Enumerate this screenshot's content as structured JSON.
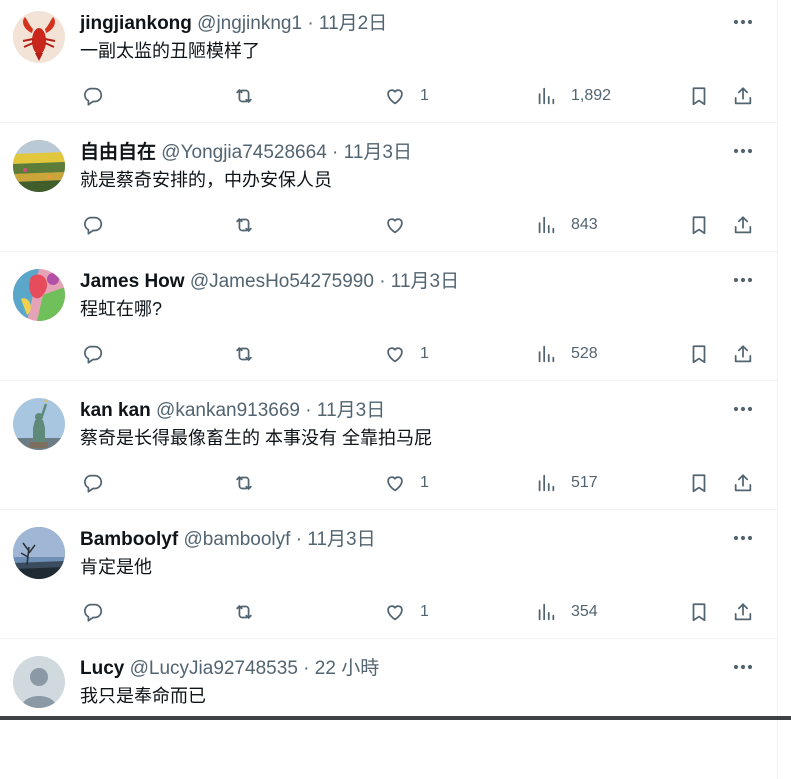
{
  "tweets": [
    {
      "name": "jingjiankong",
      "handle": "@jngjinkng1",
      "dot": "·",
      "time": "11月2日",
      "text": "一副太监的丑陋模样了",
      "replies": "",
      "retweets": "",
      "likes": "1",
      "views": "1,892",
      "avatar_icon": "lobster-avatar"
    },
    {
      "name": "自由自在",
      "handle": "@Yongjia74528664",
      "dot": "·",
      "time": "11月3日",
      "text": "就是蔡奇安排的，中办安保人员",
      "replies": "",
      "retweets": "",
      "likes": "",
      "views": "843",
      "avatar_icon": "flower-field-avatar"
    },
    {
      "name": "James How",
      "handle": "@JamesHo54275990",
      "dot": "·",
      "time": "11月3日",
      "text": "程虹在哪?",
      "replies": "",
      "retweets": "",
      "likes": "1",
      "views": "528",
      "avatar_icon": "painting-avatar"
    },
    {
      "name": "kan kan",
      "handle": "@kankan913669",
      "dot": "·",
      "time": "11月3日",
      "text": "蔡奇是长得最像畜生的 本事没有 全靠拍马屁",
      "replies": "",
      "retweets": "",
      "likes": "1",
      "views": "517",
      "avatar_icon": "statue-of-liberty-avatar"
    },
    {
      "name": "Bamboolyf",
      "handle": "@bamboolyf",
      "dot": "·",
      "time": "11月3日",
      "text": "肯定是他",
      "replies": "",
      "retweets": "",
      "likes": "1",
      "views": "354",
      "avatar_icon": "landscape-tree-avatar"
    },
    {
      "name": "Lucy",
      "handle": "@LucyJia92748535",
      "dot": "·",
      "time": "22 小時",
      "text": "我只是奉命而已",
      "replies": "",
      "retweets": "",
      "likes": "",
      "views": "",
      "avatar_icon": "default-user-avatar"
    }
  ],
  "icons": {
    "more": "more-icon",
    "reply": "reply-icon",
    "retweet": "retweet-icon",
    "like": "heart-icon",
    "views": "views-icon",
    "bookmark": "bookmark-icon",
    "share": "share-icon"
  },
  "colors": {
    "text": "#0f1419",
    "secondary": "#536471",
    "divider": "#eff3f4"
  }
}
